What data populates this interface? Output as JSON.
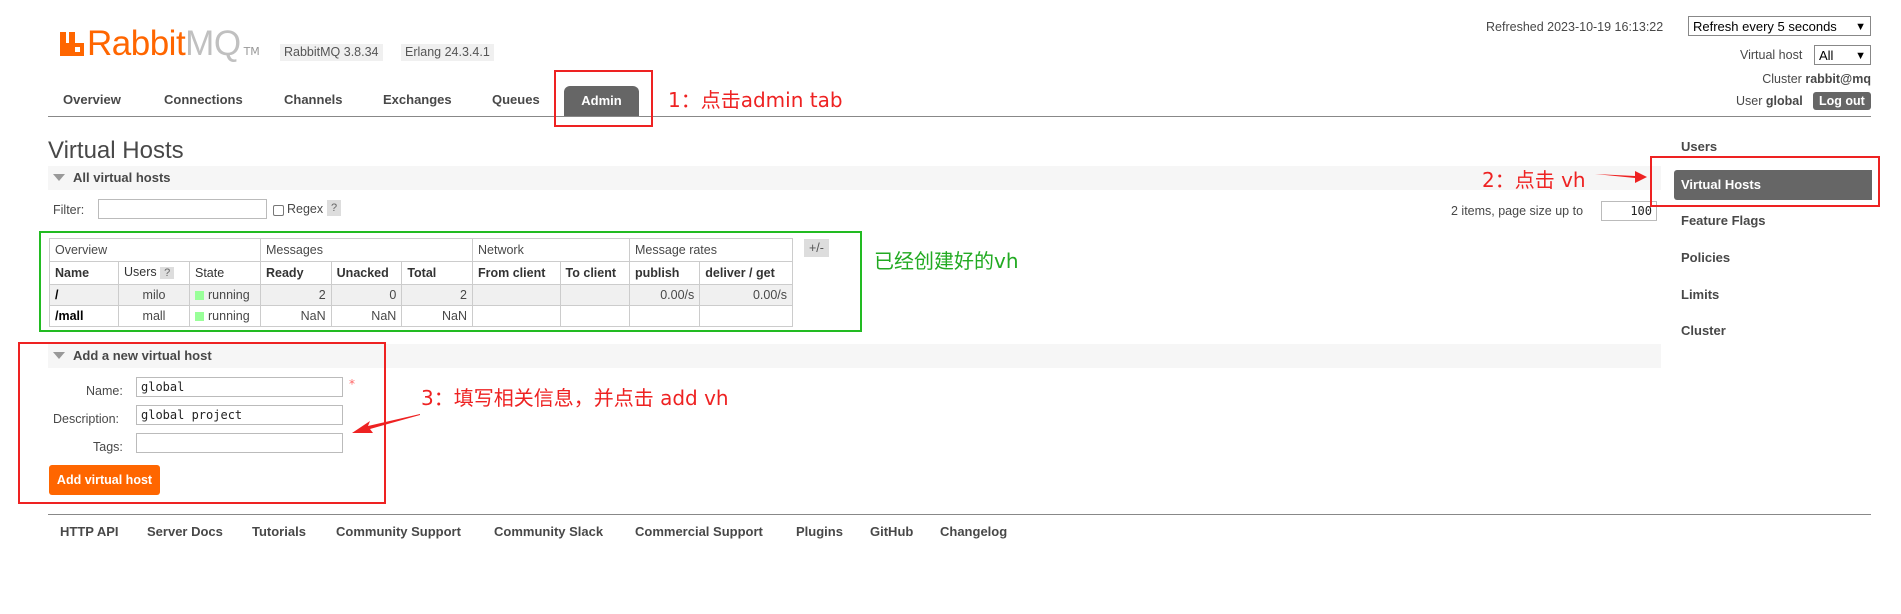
{
  "logo": {
    "rabbit": "Rabbit",
    "mq": "MQ",
    "tm": "TM"
  },
  "versions": {
    "rabbitmq": "RabbitMQ 3.8.34",
    "erlang": "Erlang 24.3.4.1"
  },
  "header": {
    "refreshed": "Refreshed 2023-10-19 16:13:22",
    "refresh_select": "Refresh every 5 seconds",
    "virtual_host_label": "Virtual host",
    "virtual_host_value": "All",
    "cluster_label": "Cluster",
    "cluster_value": "rabbit@mq",
    "user_label": "User",
    "user_value": "global",
    "logout": "Log out"
  },
  "tabs": [
    "Overview",
    "Connections",
    "Channels",
    "Exchanges",
    "Queues",
    "Admin"
  ],
  "active_tab": "Admin",
  "page_title": "Virtual Hosts",
  "all_vhosts": {
    "heading": "All virtual hosts",
    "filter_label": "Filter:",
    "filter_value": "",
    "regex_label": "Regex",
    "help": "?",
    "pagination_text": "2 items, page size up to",
    "page_size": "100"
  },
  "table": {
    "groups": [
      "Overview",
      "Messages",
      "Network",
      "Message rates"
    ],
    "plus_minus": "+/-",
    "columns": [
      "Name",
      "Users",
      "State",
      "Ready",
      "Unacked",
      "Total",
      "From client",
      "To client",
      "publish",
      "deliver / get"
    ],
    "users_help": "?",
    "rows": [
      {
        "name": "/",
        "users": "milo",
        "state": "running",
        "ready": "2",
        "unacked": "0",
        "total": "2",
        "from_client": "",
        "to_client": "",
        "publish": "0.00/s",
        "deliver_get": "0.00/s"
      },
      {
        "name": "/mall",
        "users": "mall",
        "state": "running",
        "ready": "NaN",
        "unacked": "NaN",
        "total": "NaN",
        "from_client": "",
        "to_client": "",
        "publish": "",
        "deliver_get": ""
      }
    ]
  },
  "add_vhost": {
    "heading": "Add a new virtual host",
    "name_label": "Name:",
    "name_value": "global",
    "required_mark": "*",
    "description_label": "Description:",
    "description_value": "global project",
    "tags_label": "Tags:",
    "tags_value": "",
    "submit": "Add virtual host"
  },
  "sidebar": [
    "Users",
    "Virtual Hosts",
    "Feature Flags",
    "Policies",
    "Limits",
    "Cluster"
  ],
  "sidebar_active": "Virtual Hosts",
  "footer": [
    "HTTP API",
    "Server Docs",
    "Tutorials",
    "Community Support",
    "Community Slack",
    "Commercial Support",
    "Plugins",
    "GitHub",
    "Changelog"
  ],
  "annotations": {
    "step1": "1：点击admin tab",
    "step2": "2：点击 vh",
    "step3": "3：填写相关信息，并点击 add vh",
    "created": "已经创建好的vh"
  },
  "colors": {
    "brand": "#ff6600",
    "annotation_red": "#ee2222",
    "annotation_green": "#22aa22",
    "active_tab": "#666666"
  }
}
